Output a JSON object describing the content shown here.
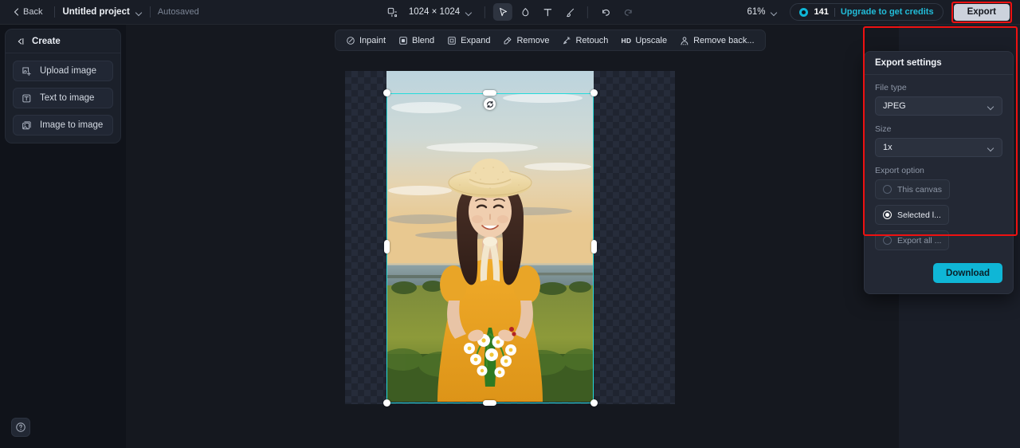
{
  "topbar": {
    "back_label": "Back",
    "project_name": "Untitled project",
    "autosaved_label": "Autosaved",
    "canvas_size": "1024 × 1024",
    "zoom_level": "61%",
    "credits_count": "141",
    "upgrade_label": "Upgrade to get credits",
    "export_label": "Export",
    "tools": [
      {
        "name": "frame-icon",
        "title": "Frame"
      },
      {
        "name": "cursor-icon",
        "title": "Select",
        "active": true
      },
      {
        "name": "eraser-icon",
        "title": "Eraser"
      },
      {
        "name": "text-icon",
        "title": "Text"
      },
      {
        "name": "brush-icon",
        "title": "Brush"
      },
      {
        "name": "undo-icon",
        "title": "Undo"
      },
      {
        "name": "redo-icon",
        "title": "Redo"
      }
    ]
  },
  "sidebar": {
    "title": "Create",
    "items": [
      {
        "label": "Upload image",
        "icon": "upload-image-icon"
      },
      {
        "label": "Text to image",
        "icon": "text-to-image-icon"
      },
      {
        "label": "Image to image",
        "icon": "image-to-image-icon"
      }
    ]
  },
  "canvas_toolbar": {
    "items": [
      {
        "label": "Inpaint",
        "icon": "inpaint-icon"
      },
      {
        "label": "Blend",
        "icon": "blend-icon"
      },
      {
        "label": "Expand",
        "icon": "expand-icon"
      },
      {
        "label": "Remove",
        "icon": "remove-icon"
      },
      {
        "label": "Retouch",
        "icon": "retouch-icon"
      },
      {
        "label": "Upscale",
        "icon": "hd-upscale-icon",
        "badge": "HD"
      },
      {
        "label": "Remove back...",
        "icon": "remove-background-icon"
      }
    ]
  },
  "export_panel": {
    "title": "Export settings",
    "file_type_label": "File type",
    "file_type_value": "JPEG",
    "size_label": "Size",
    "size_value": "1x",
    "export_option_label": "Export option",
    "options": [
      {
        "label": "This canvas",
        "selected": false
      },
      {
        "label": "Selected l...",
        "selected": true
      },
      {
        "label": "Export all ...",
        "selected": false
      }
    ],
    "download_label": "Download"
  },
  "help": {
    "label": "?"
  },
  "colors": {
    "accent_cyan": "#0fb6d6",
    "selection_cyan": "#24dbdb",
    "annotation_red": "#ee1111",
    "panel_bg": "#232834",
    "app_bg": "#10131a"
  }
}
